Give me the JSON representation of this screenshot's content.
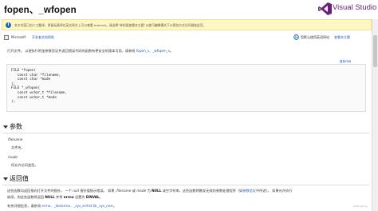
{
  "header": {
    "title": "fopen、_wfopen",
    "logo_text": "Visual Studio",
    "logo_color": "#68217a"
  },
  "notice": {
    "text": "本文内容已由人工翻译。将鼠标悬停在英文原文上可以查看 Internet。请选择“单机版查看本主题”以使可编辑模式下以预览方式访问器各此页。"
  },
  "source_bar": {
    "label": "Microsoft",
    "link": "开发者文档帮助",
    "share_text": "您默认使用英语网站",
    "share_link": "查看本主题"
  },
  "intro": {
    "text": "打开文件。 以使执行附加参数验证并返回错误代码的函数有更安全的版本可用，请参阅",
    "link1": "fopen_s、_wfopen_s",
    "suffix": "。"
  },
  "syntax": {
    "link": "复制代码",
    "lines": [
      "FILE *fopen(",
      "   const char *filename,",
      "   const char *mode",
      ");",
      "FILE *_wfopen(",
      "   const wchar_t *filename,",
      "   const wchar_t *mode",
      ");"
    ]
  },
  "params": {
    "heading": "参数",
    "items": [
      {
        "name": "filename",
        "desc": "文件名。"
      },
      {
        "name": "mode",
        "desc": "所允许访问类型。"
      }
    ]
  },
  "returns": {
    "heading": "返回值",
    "p1_a": "这些函数均返回指向打开文件的指针。 一个",
    "p1_null": "null",
    "p1_b": "指针值指示错误。 如果,",
    "p1_filename": "filename",
    "p1_c": "或",
    "p1_mode": "mode",
    "p1_d": "为",
    "p1_NULL": "NULL",
    "p1_e": "或空字符串，这些函数将触发无效的参数处理程序（如",
    "p1_link": "参数验证",
    "p1_f": "中所述）。 如果允许执行",
    "p2_a": "继续，则这些函数将返回",
    "p2_NULL": "NULL",
    "p2_b": "并将",
    "p2_errno": "errno",
    "p2_c": "设置为",
    "p2_EINVAL": "EINVAL",
    "p2_d": "。",
    "p3_a": "有关详细信息，请参阅",
    "p3_links": "errno、_doserrno、_sys_errlist 和 _sys_nerr",
    "p3_b": "。"
  },
  "watermark": "CSDN @tony"
}
